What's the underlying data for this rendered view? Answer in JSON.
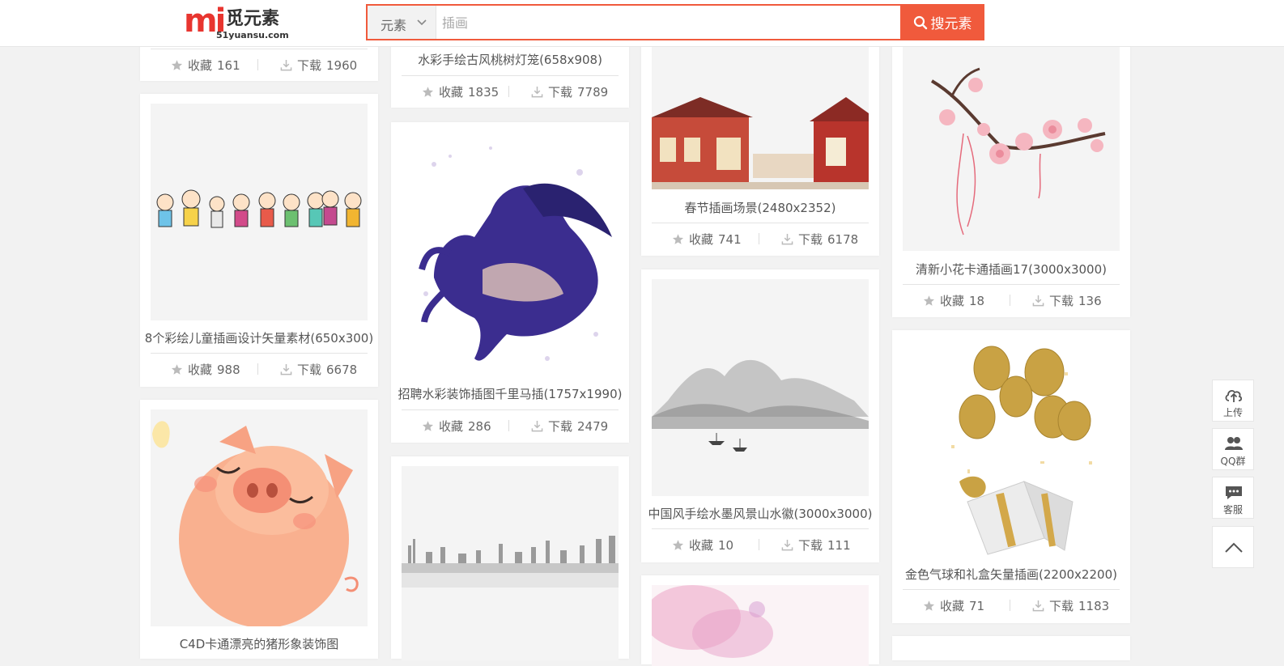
{
  "header": {
    "logo": {
      "mark": "mi",
      "cn": "觅元素",
      "en": "51yuansu.com"
    },
    "search": {
      "category": "元素",
      "placeholder": "插画",
      "button": "搜元素"
    }
  },
  "labels": {
    "fav": "收藏",
    "dl": "下载"
  },
  "cards": [
    {
      "title": "",
      "fav": "161",
      "dl": "1960"
    },
    {
      "title": "8个彩绘儿童插画设计矢量素材(650x300)",
      "fav": "988",
      "dl": "6678"
    },
    {
      "title": "C4D卡通漂亮的猪形象装饰图"
    },
    {
      "title": "水彩手绘古风桃树灯笼(658x908)",
      "fav": "1835",
      "dl": "7789"
    },
    {
      "title": "招聘水彩装饰插图千里马插(1757x1990)",
      "fav": "286",
      "dl": "2479"
    },
    {
      "title": ""
    },
    {
      "title": "春节插画场景(2480x2352)",
      "fav": "741",
      "dl": "6178"
    },
    {
      "title": "中国风手绘水墨风景山水徽(3000x3000)",
      "fav": "10",
      "dl": "111"
    },
    {
      "title": ""
    },
    {
      "title": "清新小花卡通插画17(3000x3000)",
      "fav": "18",
      "dl": "136"
    },
    {
      "title": "金色气球和礼盒矢量插画(2200x2200)",
      "fav": "71",
      "dl": "1183"
    }
  ],
  "tools": {
    "upload": "上传",
    "qq": "QQ群",
    "service": "客服"
  },
  "icons": {
    "fav": "star-icon",
    "dl": "download-icon"
  },
  "colors": {
    "accent": "#f05a3c",
    "logo_red": "#e8352f"
  }
}
